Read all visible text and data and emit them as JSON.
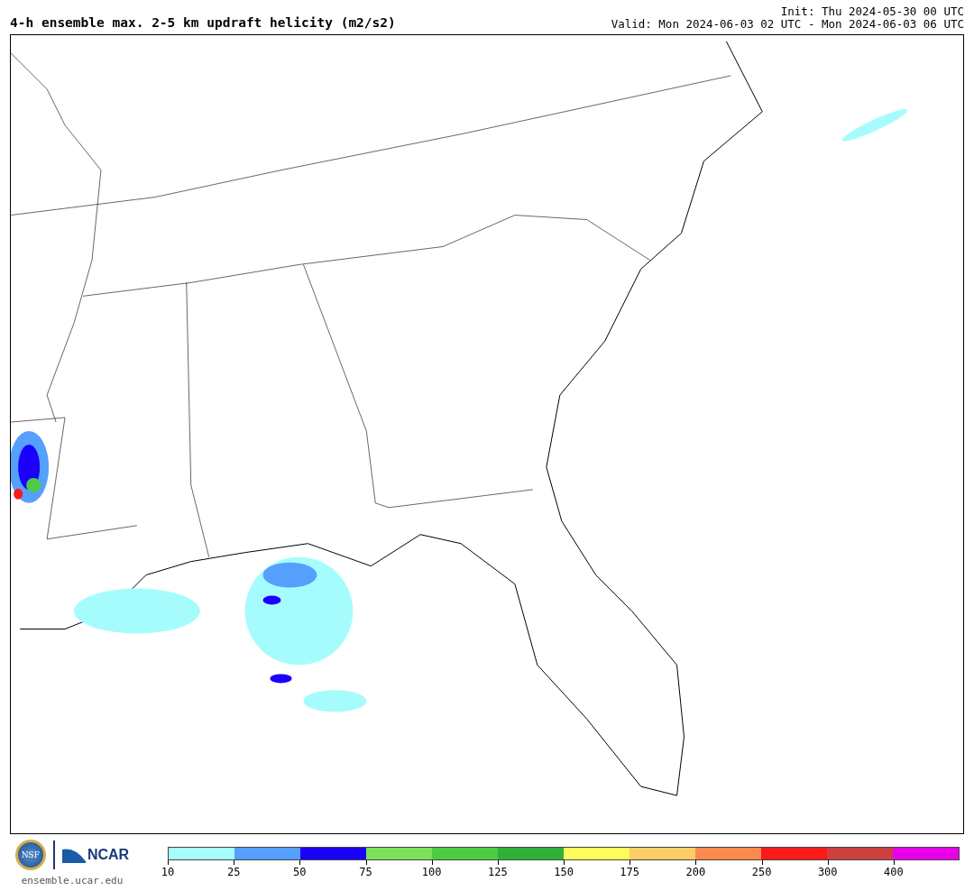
{
  "header": {
    "title": "4-h ensemble max. 2-5 km updraft helicity (m2/s2)",
    "init": "Init: Thu 2024-05-30 00 UTC",
    "valid": "Valid: Mon 2024-06-03 02 UTC - Mon 2024-06-03 06 UTC"
  },
  "logos": {
    "nsf": "NSF",
    "ncar": "NCAR",
    "site": "ensemble.ucar.edu"
  },
  "colorbar": {
    "segments": [
      {
        "label": "10",
        "color": "#a6fcfc"
      },
      {
        "label": "25",
        "color": "#55a0fc"
      },
      {
        "label": "50",
        "color": "#1a00fc"
      },
      {
        "label": "75",
        "color": "#7ce25a"
      },
      {
        "label": "100",
        "color": "#4ccc44"
      },
      {
        "label": "125",
        "color": "#2fb039"
      },
      {
        "label": "150",
        "color": "#fcfc5c"
      },
      {
        "label": "175",
        "color": "#fccc66"
      },
      {
        "label": "200",
        "color": "#fc8a4e"
      },
      {
        "label": "250",
        "color": "#fc1a1a"
      },
      {
        "label": "300",
        "color": "#cc4040"
      },
      {
        "label": "400",
        "color": "#e800e8"
      }
    ]
  }
}
